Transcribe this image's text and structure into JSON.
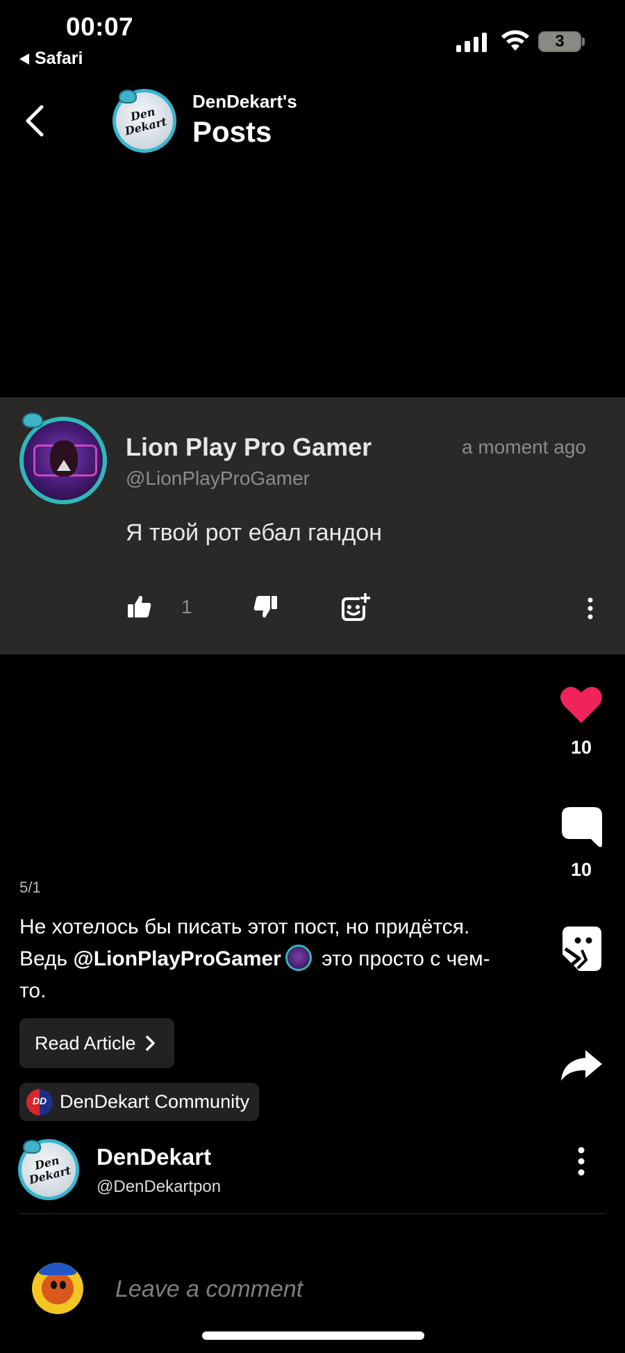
{
  "status_bar": {
    "time": "00:07",
    "back_app": "Safari",
    "battery_level": "3",
    "icons": [
      "signal-icon",
      "wifi-icon",
      "battery-icon"
    ]
  },
  "header": {
    "subtitle": "DenDekart's",
    "title": "Posts",
    "avatar_text_line1": "Den",
    "avatar_text_line2": "Dekart"
  },
  "comment_overlay": {
    "author_name": "Lion Play Pro Gamer",
    "author_handle": "@LionPlayProGamer",
    "timestamp": "a moment ago",
    "text": "Я твой рот ебал гандон",
    "like_count": "1"
  },
  "actions": {
    "likes": "10",
    "comments": "10"
  },
  "post": {
    "page_indicator": "5/1",
    "text_before": "Не хотелось бы писать этот пост, но придётся. Ведь ",
    "mention": "@LionPlayProGamer",
    "text_after": " это просто с чем-то.",
    "read_article": "Read Article",
    "community": "DenDekart Community",
    "community_logo_text": "DD"
  },
  "author": {
    "name": "DenDekart",
    "handle": "@DenDekartpon"
  },
  "comment_box": {
    "placeholder": "Leave a comment"
  },
  "colors": {
    "heart": "#f0245a",
    "card_bg": "#2b2828",
    "chip_bg": "#232222",
    "avatar_ring": "#37b5d0"
  }
}
